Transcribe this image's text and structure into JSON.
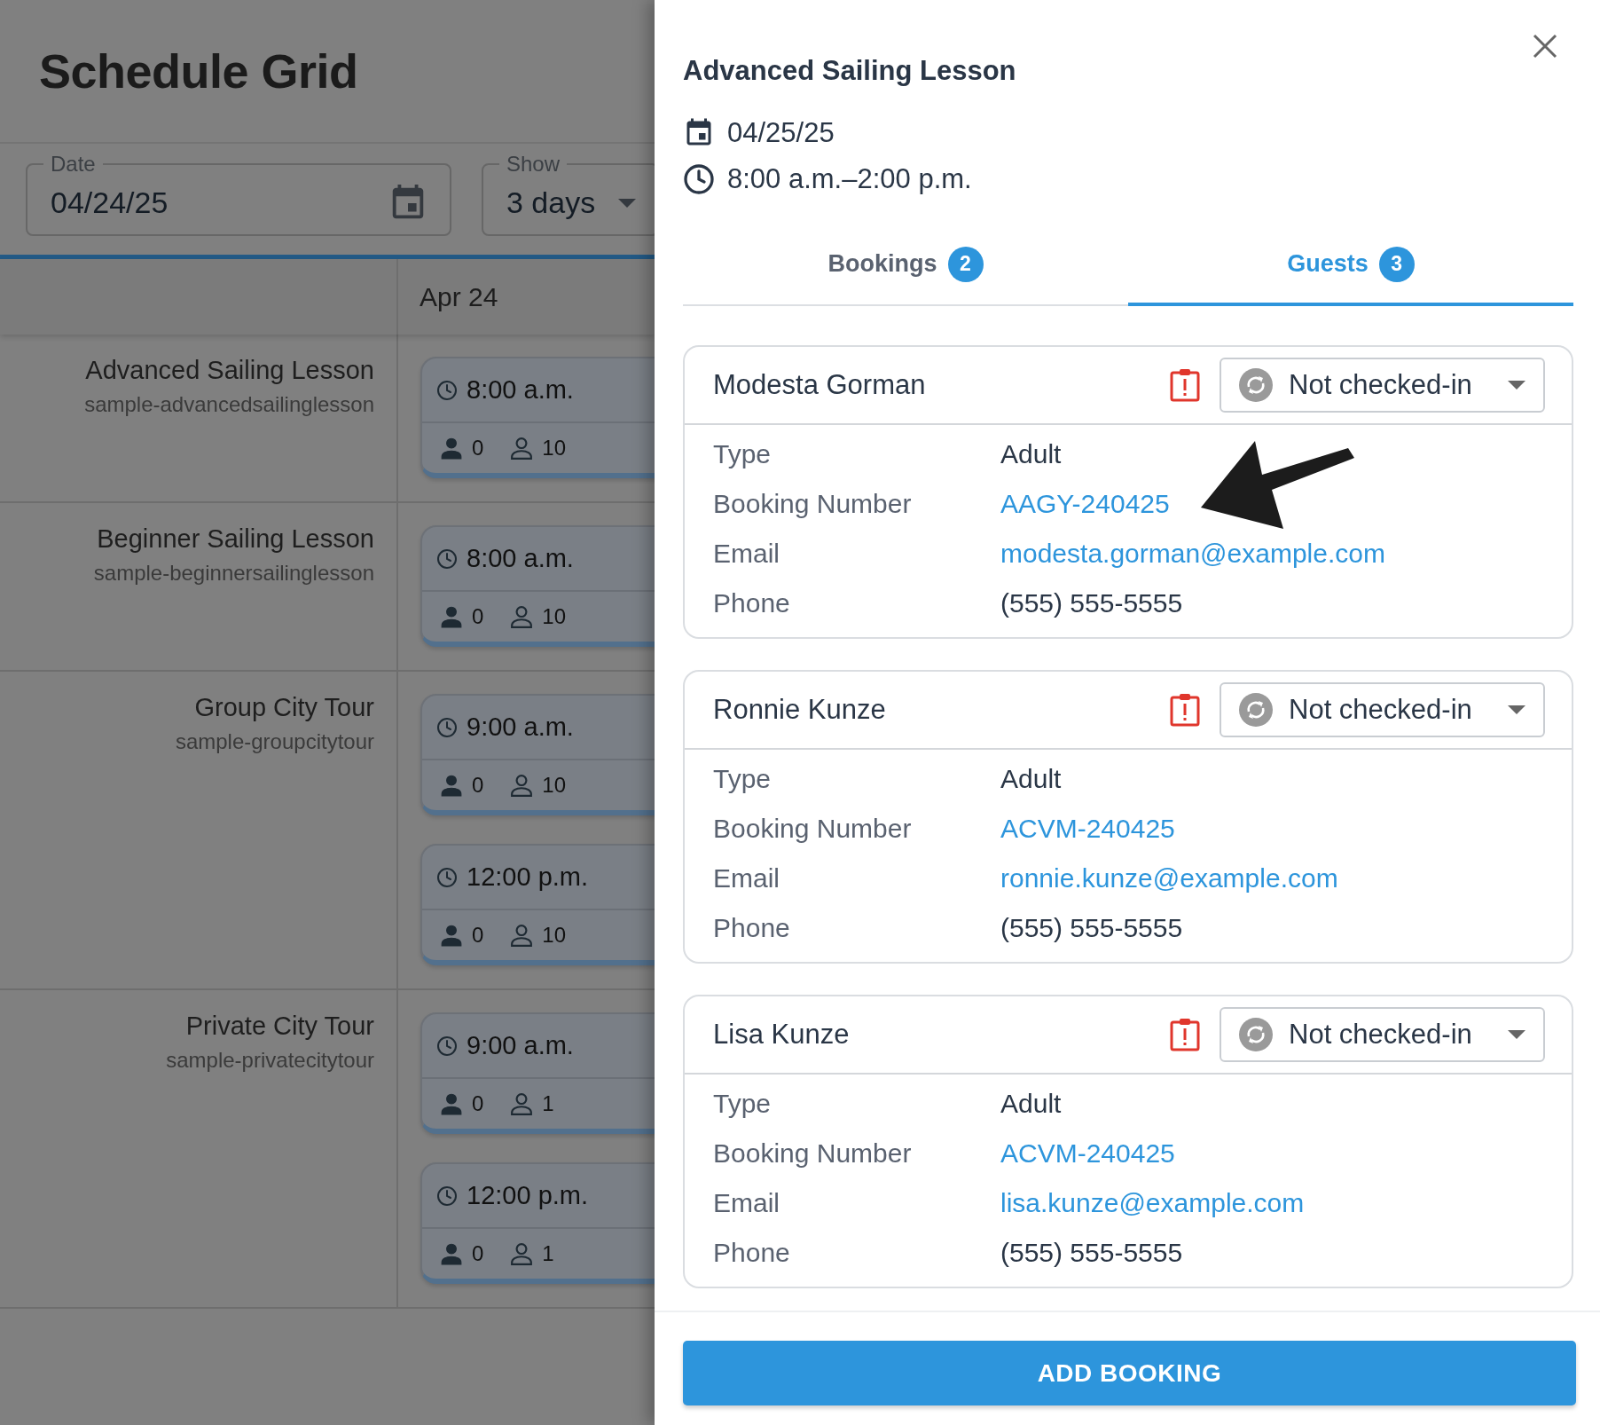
{
  "page_title": "Schedule Grid",
  "filters": {
    "date": {
      "label": "Date",
      "value": "04/24/25"
    },
    "show": {
      "label": "Show",
      "value": "3 days"
    }
  },
  "grid": {
    "day_header": "Apr 24",
    "rows": [
      {
        "name": "Advanced Sailing Lesson",
        "code": "sample-advancedsailinglesson",
        "slots": [
          {
            "time": "8:00 a.m.",
            "booked": "0",
            "capacity": "10"
          }
        ]
      },
      {
        "name": "Beginner Sailing Lesson",
        "code": "sample-beginnersailinglesson",
        "slots": [
          {
            "time": "8:00 a.m.",
            "booked": "0",
            "capacity": "10"
          }
        ]
      },
      {
        "name": "Group City Tour",
        "code": "sample-groupcitytour",
        "slots": [
          {
            "time": "9:00 a.m.",
            "booked": "0",
            "capacity": "10"
          },
          {
            "time": "12:00 p.m.",
            "booked": "0",
            "capacity": "10"
          }
        ]
      },
      {
        "name": "Private City Tour",
        "code": "sample-privatecitytour",
        "slots": [
          {
            "time": "9:00 a.m.",
            "booked": "0",
            "capacity": "1"
          },
          {
            "time": "12:00 p.m.",
            "booked": "0",
            "capacity": "1"
          }
        ]
      }
    ]
  },
  "drawer": {
    "title": "Advanced Sailing Lesson",
    "date": "04/25/25",
    "time": "8:00 a.m.–2:00 p.m.",
    "tabs": [
      {
        "label": "Bookings",
        "count": "2",
        "selected": false
      },
      {
        "label": "Guests",
        "count": "3",
        "selected": true
      }
    ],
    "guests": [
      {
        "name": "Modesta Gorman",
        "alert": true,
        "status": "Not checked-in",
        "fields": [
          {
            "label": "Type",
            "value": "Adult",
            "kind": "text"
          },
          {
            "label": "Booking Number",
            "value": "AAGY-240425",
            "kind": "link"
          },
          {
            "label": "Email",
            "value": "modesta.gorman@example.com",
            "kind": "link"
          },
          {
            "label": "Phone",
            "value": "(555) 555-5555",
            "kind": "text"
          }
        ]
      },
      {
        "name": "Ronnie Kunze",
        "alert": true,
        "status": "Not checked-in",
        "fields": [
          {
            "label": "Type",
            "value": "Adult",
            "kind": "text"
          },
          {
            "label": "Booking Number",
            "value": "ACVM-240425",
            "kind": "link"
          },
          {
            "label": "Email",
            "value": "ronnie.kunze@example.com",
            "kind": "link"
          },
          {
            "label": "Phone",
            "value": "(555) 555-5555",
            "kind": "text"
          }
        ]
      },
      {
        "name": "Lisa Kunze",
        "alert": true,
        "status": "Not checked-in",
        "fields": [
          {
            "label": "Type",
            "value": "Adult",
            "kind": "text"
          },
          {
            "label": "Booking Number",
            "value": "ACVM-240425",
            "kind": "link"
          },
          {
            "label": "Email",
            "value": "lisa.kunze@example.com",
            "kind": "link"
          },
          {
            "label": "Phone",
            "value": "(555) 555-5555",
            "kind": "text"
          }
        ]
      }
    ],
    "button": "ADD BOOKING"
  }
}
